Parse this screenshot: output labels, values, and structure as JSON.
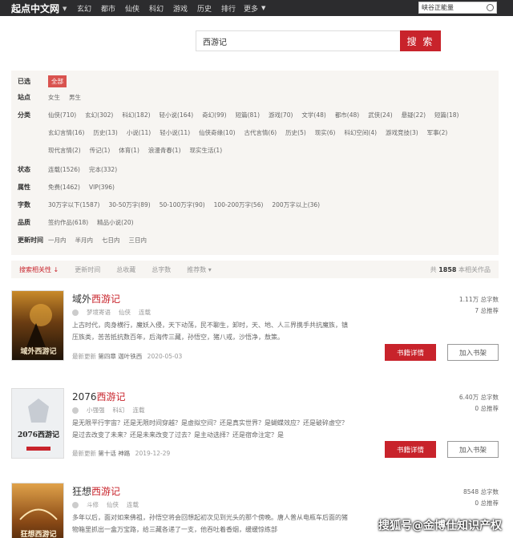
{
  "topnav": {
    "logo": "起点中文网",
    "links": [
      "玄幻",
      "都市",
      "仙侠",
      "科幻",
      "游戏",
      "历史",
      "排行"
    ],
    "more": "更多",
    "search_value": "峡谷正能量"
  },
  "search": {
    "value": "西游记",
    "button": "搜 索"
  },
  "filters": {
    "selected": {
      "label": "已选",
      "value": "全部"
    },
    "site": {
      "label": "站点",
      "options": [
        "女生",
        "男生"
      ]
    },
    "category": {
      "label": "分类",
      "row1": [
        "仙侠(710)",
        "玄幻(302)",
        "科幻(182)",
        "轻小说(164)",
        "奇幻(99)",
        "短篇(81)",
        "游戏(70)",
        "文学(48)",
        "都市(48)",
        "武侠(24)",
        "悬疑(22)",
        "短篇(18)"
      ],
      "row2": [
        "玄幻言情(16)",
        "历史(13)",
        "小说(11)",
        "轻小说(11)",
        "仙侠奇缘(10)",
        "古代言情(6)",
        "历史(5)",
        "现实(6)",
        "科幻空间(4)",
        "游戏竞技(3)",
        "军事(2)"
      ],
      "row3": [
        "现代言情(2)",
        "传记(1)",
        "体育(1)",
        "浪漫青春(1)",
        "现实生活(1)"
      ]
    },
    "status": {
      "label": "状态",
      "options": [
        "连载(1526)",
        "完本(332)"
      ]
    },
    "attribute": {
      "label": "属性",
      "options": [
        "免费(1462)",
        "VIP(396)"
      ]
    },
    "wordcount": {
      "label": "字数",
      "options": [
        "30万字以下(1587)",
        "30-50万字(89)",
        "50-100万字(90)",
        "100-200万字(56)",
        "200万字以上(36)"
      ]
    },
    "quality": {
      "label": "品质",
      "options": [
        "签约作品(618)",
        "精品小说(20)"
      ]
    },
    "updated": {
      "label": "更新时间",
      "options": [
        "一月内",
        "半月内",
        "七日内",
        "三日内"
      ]
    }
  },
  "sortbar": {
    "items": [
      "搜索相关性 ↓",
      "更新时间",
      "总收藏",
      "总字数",
      "推荐数 ▾"
    ],
    "count_prefix": "共",
    "count": "1858",
    "count_suffix": "本相关作品"
  },
  "books": [
    {
      "title_pre": "域外",
      "title_hl": "西游记",
      "author": "梦境寄语",
      "genre": "仙侠",
      "status": "连载",
      "desc": "上古时代，肉身横行，魔妖入侵，天下动荡，民不聊生，卸时，天、地、人三界携手共抗魔族，镇压族类，苦苦抵抗数百年，后海传三藏，孙悟空，猪八戒，沙悟净，敖策。",
      "update_label": "最新更新",
      "update_chapter": "第四章 迦叶铁西",
      "update_date": "2020-05-03",
      "words": "1.11万 总字数",
      "recs": "7 总推荐",
      "detail": "书籍详情",
      "shelf": "加入书架",
      "cover_text": "域外西游记",
      "cover_bg": "#3a2a14"
    },
    {
      "title_pre": "2076",
      "title_hl": "西游记",
      "author": "小强强",
      "genre": "科幻",
      "status": "连载",
      "desc": "是无限平行宇宙？还是无限时间穿越？是虚拟空间？还是真实世界？是蝴蝶效应？还是破碎虚空？是过去改变了未来？还是未来改变了过去？是主动选择？还是宿命注定？是",
      "update_label": "最新更新",
      "update_chapter": "第十话 神路",
      "update_date": "2019-12-29",
      "words": "6.40万 总字数",
      "recs": "0 总推荐",
      "detail": "书籍详情",
      "shelf": "加入书架",
      "cover_text": "2076西游记",
      "cover_bg": "#e9ecef"
    },
    {
      "title_pre": "狂想",
      "title_hl": "西游记",
      "author": "斗修",
      "genre": "仙侠",
      "status": "连载",
      "desc": "多年以后，面对如来佛祖，孙悟空将会回想起初次见到光头的那个傍晚。唐人普从电瓶车后面的猪物箱里抓出一盒万宝路，给三藏各递了一支，他吞吐着香烟，缓缓惊练部",
      "words": "8548 总字数",
      "recs": "0 总推荐",
      "cover_text": "狂想西游记",
      "cover_bg": "#7a3e12"
    }
  ],
  "watermark": "搜狐号@金博仕知识产权"
}
